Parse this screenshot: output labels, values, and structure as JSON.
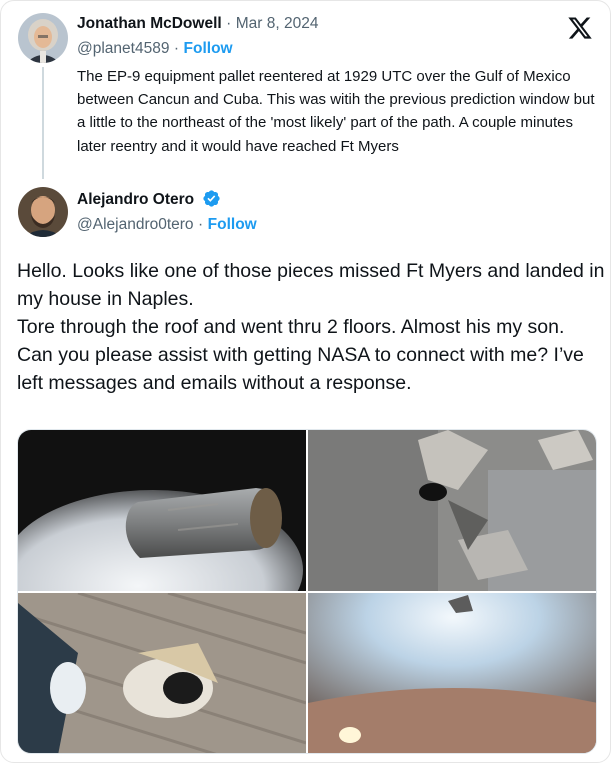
{
  "quoted_tweet": {
    "author_name": "Jonathan McDowell",
    "date": "Mar 8, 2024",
    "handle": "@planet4589",
    "follow_label": "Follow",
    "text": "The EP-9 equipment pallet reentered at 1929 UTC over the Gulf of Mexico between Cancun and Cuba. This was witih the previous prediction window but a little to the northeast of the 'most likely' part of the path. A couple minutes later reentry and it would have reached Ft Myers"
  },
  "reply_tweet": {
    "author_name": "Alejandro Otero",
    "handle": "@Alejandro0tero",
    "follow_label": "Follow",
    "verified": true,
    "paragraphs": [
      "Hello. Looks like one of those pieces missed Ft Myers and landed in my house in Naples.",
      "Tore through the roof and went  thru 2 floors. Almost his my son.",
      "Can you please assist with getting NASA to connect with me? I’ve left messages and emails without a response."
    ]
  },
  "separator": "·",
  "media_count": 4,
  "icons": [
    "x-logo-icon",
    "verified-badge-icon"
  ],
  "colors": {
    "follow": "#1d9bf0",
    "muted": "#536471",
    "text": "#0f1419",
    "verified": "#1d9bf0"
  }
}
